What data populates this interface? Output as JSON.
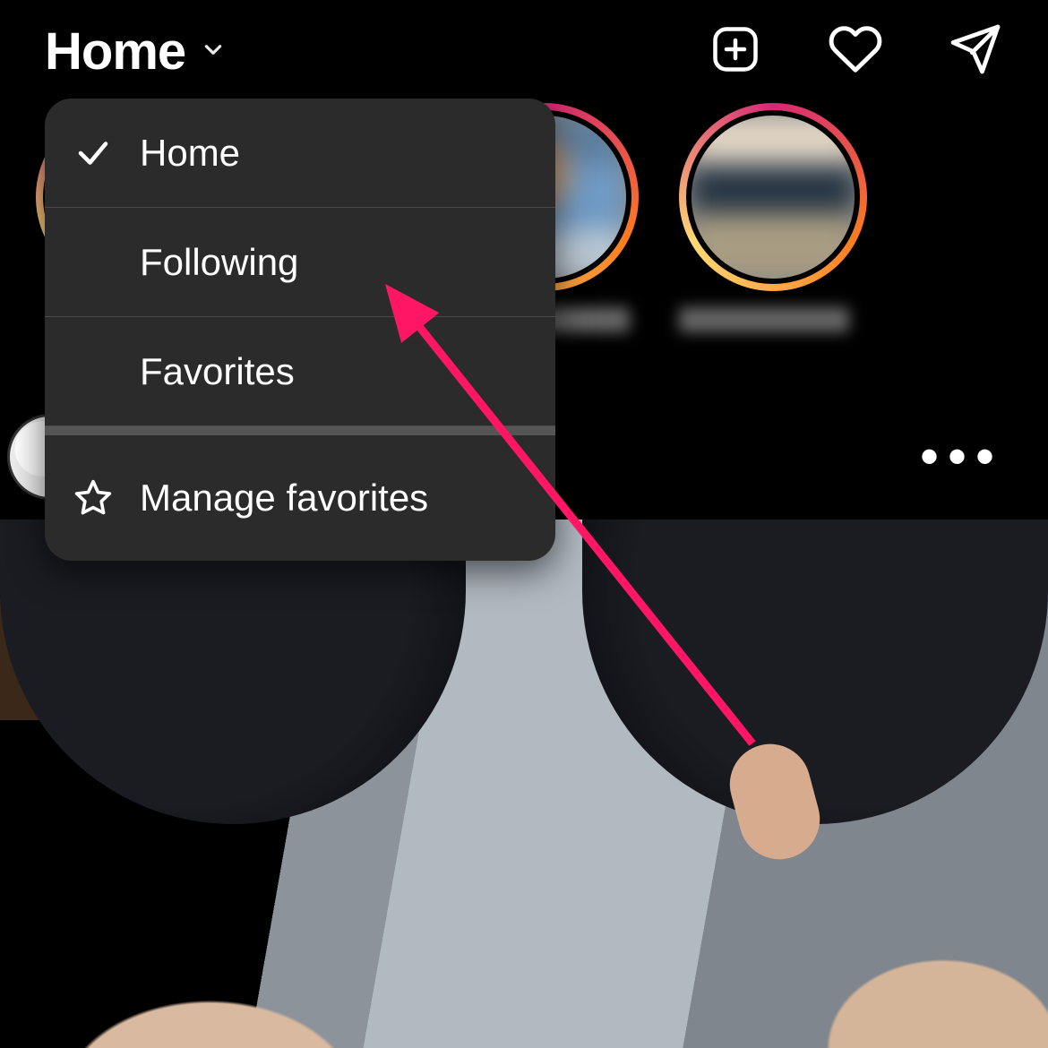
{
  "header": {
    "title": "Home"
  },
  "dropdown": {
    "items": [
      {
        "label": "Home",
        "selected": true
      },
      {
        "label": "Following",
        "selected": false
      },
      {
        "label": "Favorites",
        "selected": false
      }
    ],
    "manage_label": "Manage favorites"
  },
  "post": {
    "more_glyph": "•••"
  },
  "annotation": {
    "color": "#ff1765",
    "target": "dropdown.items.1"
  }
}
